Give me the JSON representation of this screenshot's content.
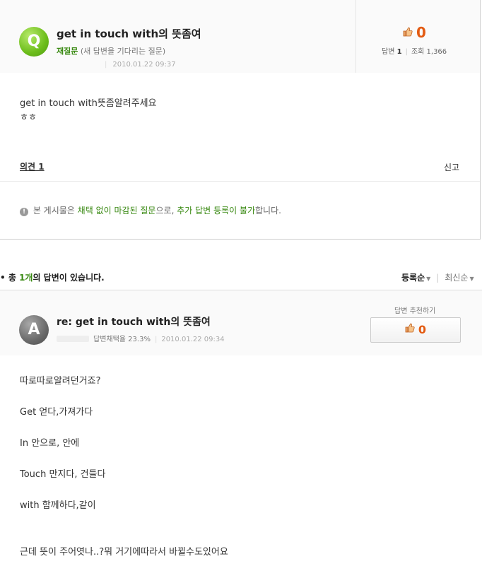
{
  "question": {
    "badge": "Q",
    "title": "get in touch with의 뜻좀여",
    "status_label": "재질문",
    "status_desc": "(새 답변을 기다리는 질문)",
    "date": "2010.01.22 09:37",
    "recommend_count": "0",
    "answers_label": "답변",
    "answers_count": "1",
    "views_label": "조회",
    "views_count": "1,366",
    "body_line1": "get in touch with뜻좀알려주세요",
    "body_line2": "ㅎㅎ",
    "opinion_link": "의견 1",
    "report_link": "신고",
    "notice": {
      "icon": "!",
      "p1": "본 게시물은 ",
      "p2": "채택 없이 마감된 질문",
      "p3": "으로, ",
      "p4": "추가 답변 등록이 불가",
      "p5": "합니다."
    }
  },
  "answers_header": {
    "bullet": "•",
    "prefix": "총 ",
    "count": "1개",
    "suffix": "의 답변이 있습니다.",
    "sort_registered": "등록순",
    "sort_latest": "최신순"
  },
  "answer": {
    "badge": "A",
    "title": "re: get in touch with의 뜻좀여",
    "adoption": "답변채택율 23.3%",
    "date": "2010.01.22 09:34",
    "recommend_label": "답변 추천하기",
    "recommend_count": "0",
    "lines": [
      "따로따로알려던거죠?",
      "Get 얻다,가져가다",
      "In 안으로, 안에",
      "Touch 만지다, 건들다",
      "with 함께하다,같이",
      "근데 뜻이 주어엿나..?뭐 거기에따라서 바뀔수도있어요"
    ]
  },
  "colors": {
    "accent_green": "#3a8a13",
    "recommend_orange": "#e35b12"
  }
}
